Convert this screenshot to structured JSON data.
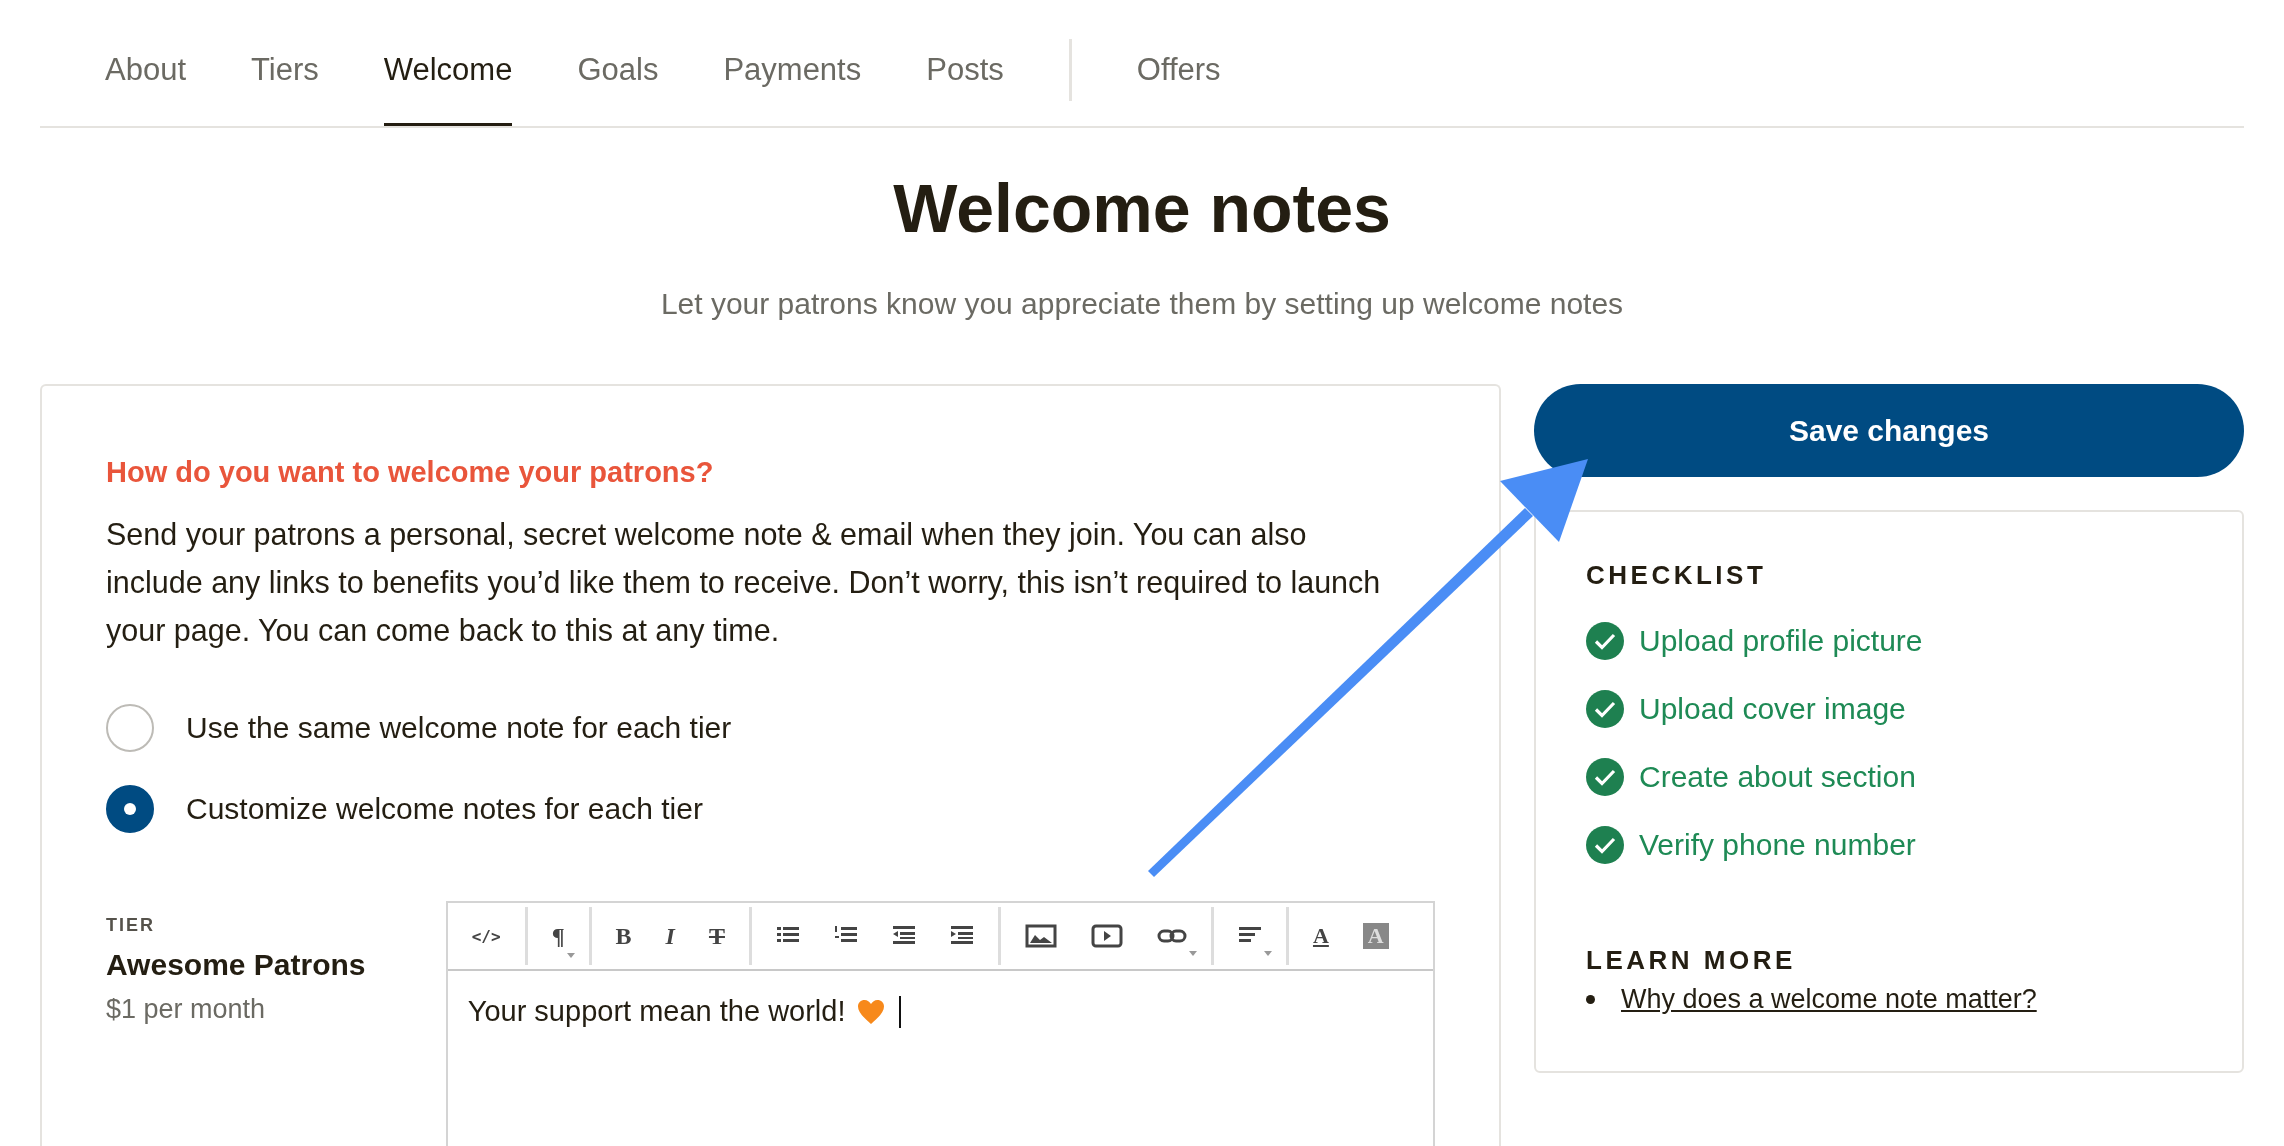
{
  "tabs": [
    {
      "label": "About",
      "selected": false
    },
    {
      "label": "Tiers",
      "selected": false
    },
    {
      "label": "Welcome",
      "selected": true
    },
    {
      "label": "Goals",
      "selected": false
    },
    {
      "label": "Payments",
      "selected": false
    },
    {
      "label": "Posts",
      "selected": false
    },
    {
      "label": "Offers",
      "selected": false,
      "separated": true
    }
  ],
  "title": "Welcome notes",
  "subtitle": "Let your patrons know you appreciate them by setting up welcome notes",
  "welcome_card": {
    "question": "How do you want to welcome your patrons?",
    "description": "Send your patrons a personal, secret welcome note & email when they join. You can also include any links to benefits you’d like them to receive. Don’t worry, this isn’t required to launch your page. You can come back to this at any time.",
    "options": [
      {
        "label": "Use the same welcome note for each tier",
        "selected": false
      },
      {
        "label": "Customize welcome notes for each tier",
        "selected": true
      }
    ],
    "tier": {
      "caption": "TIER",
      "name": "Awesome Patrons",
      "price": "$1 per month"
    },
    "toolbar": [
      [
        {
          "kind": "code",
          "label": "</>"
        }
      ],
      [
        {
          "kind": "paragraph",
          "label": "¶",
          "dropdown": true
        }
      ],
      [
        {
          "kind": "bold",
          "label": "B"
        },
        {
          "kind": "italic",
          "label": "I"
        },
        {
          "kind": "strike",
          "label": "T"
        }
      ],
      [
        {
          "kind": "bullets"
        },
        {
          "kind": "numbers"
        },
        {
          "kind": "outdent"
        },
        {
          "kind": "indent"
        }
      ],
      [
        {
          "kind": "image"
        },
        {
          "kind": "video"
        },
        {
          "kind": "link",
          "dropdown": true
        }
      ],
      [
        {
          "kind": "align",
          "dropdown": true
        }
      ],
      [
        {
          "kind": "text_color",
          "label": "A"
        },
        {
          "kind": "highlight",
          "label": "A"
        }
      ]
    ],
    "editor_text": "Your support mean the world!"
  },
  "save_button": "Save changes",
  "checklist": {
    "heading": "CHECKLIST",
    "items": [
      {
        "label": "Upload profile picture",
        "done": true
      },
      {
        "label": "Upload cover image",
        "done": true
      },
      {
        "label": "Create about section",
        "done": true
      },
      {
        "label": "Verify phone number",
        "done": true
      }
    ]
  },
  "learn_more": {
    "heading": "LEARN MORE",
    "links": [
      "Why does a welcome note matter?"
    ]
  }
}
